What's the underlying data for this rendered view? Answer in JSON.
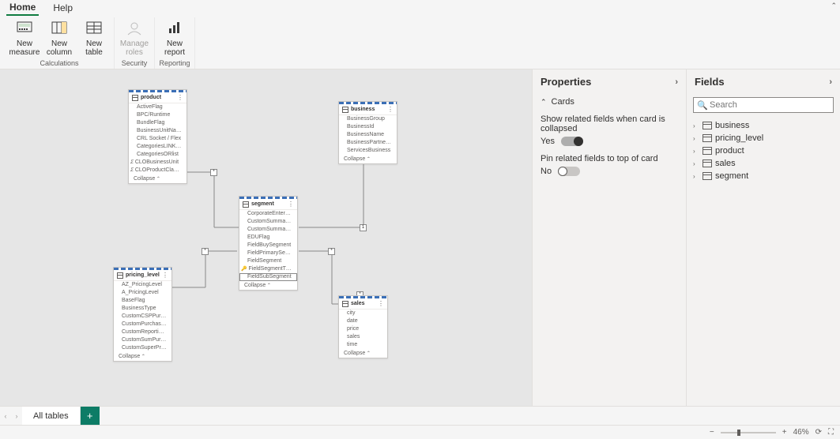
{
  "menu": {
    "home": "Home",
    "help": "Help"
  },
  "ribbon": {
    "groups": [
      {
        "label": "Calculations",
        "items": [
          {
            "id": "new-measure",
            "label": "New\nmeasure"
          },
          {
            "id": "new-column",
            "label": "New\ncolumn"
          },
          {
            "id": "new-table",
            "label": "New\ntable"
          }
        ]
      },
      {
        "label": "Security",
        "items": [
          {
            "id": "manage-roles",
            "label": "Manage\nroles",
            "disabled": true
          }
        ]
      },
      {
        "label": "Reporting",
        "items": [
          {
            "id": "new-report",
            "label": "New\nreport"
          }
        ]
      }
    ]
  },
  "cards": {
    "product": {
      "title": "product",
      "collapse": "Collapse",
      "fields": [
        "ActiveFlag",
        "BPC/Runtime",
        "BundleFlag",
        "BusinessUnitName",
        "CRL Socket / Flex",
        "CategoriesLINKField",
        "CategoriesORlist",
        "CLOBusinessUnit",
        "CLOProductClassesAndServices"
      ]
    },
    "business": {
      "title": "business",
      "collapse": "Collapse",
      "fields": [
        "BusinessGroup",
        "BusinessId",
        "BusinessName",
        "BusinessPartnerName",
        "ServicesBusiness"
      ]
    },
    "segment": {
      "title": "segment",
      "collapse": "Collapse",
      "fields": [
        "CorporateEnterpriseFlag",
        "CustomSummarySector",
        "CustomSummarySegment",
        "EDUFlag",
        "FieldBuySegment",
        "FieldPrimarySegment",
        "FieldSegment",
        "FieldSegmentType",
        "FieldSubSegment"
      ]
    },
    "pricing": {
      "title": "pricing_level",
      "collapse": "Collapse",
      "fields": [
        "AZ_PricingLevel",
        "A_PricingLevel",
        "BaseFlag",
        "BusinessType",
        "CustomCSPPurchaseType",
        "CustomPurchaseType",
        "CustomReportingSummaryPur...",
        "CustomSumPurchaseType",
        "CustomSuperPricingLevel"
      ]
    },
    "sales": {
      "title": "sales",
      "collapse": "Collapse",
      "fields": [
        "city",
        "date",
        "price",
        "sales",
        "time"
      ]
    }
  },
  "properties": {
    "title": "Properties",
    "section": "Cards",
    "setting1": "Show related fields when card is collapsed",
    "setting1_value": "Yes",
    "setting2": "Pin related fields to top of card",
    "setting2_value": "No"
  },
  "fields": {
    "title": "Fields",
    "search_placeholder": "Search",
    "items": [
      "business",
      "pricing_level",
      "product",
      "sales",
      "segment"
    ]
  },
  "tabs": {
    "all": "All tables"
  },
  "status": {
    "zoom": "46%"
  }
}
